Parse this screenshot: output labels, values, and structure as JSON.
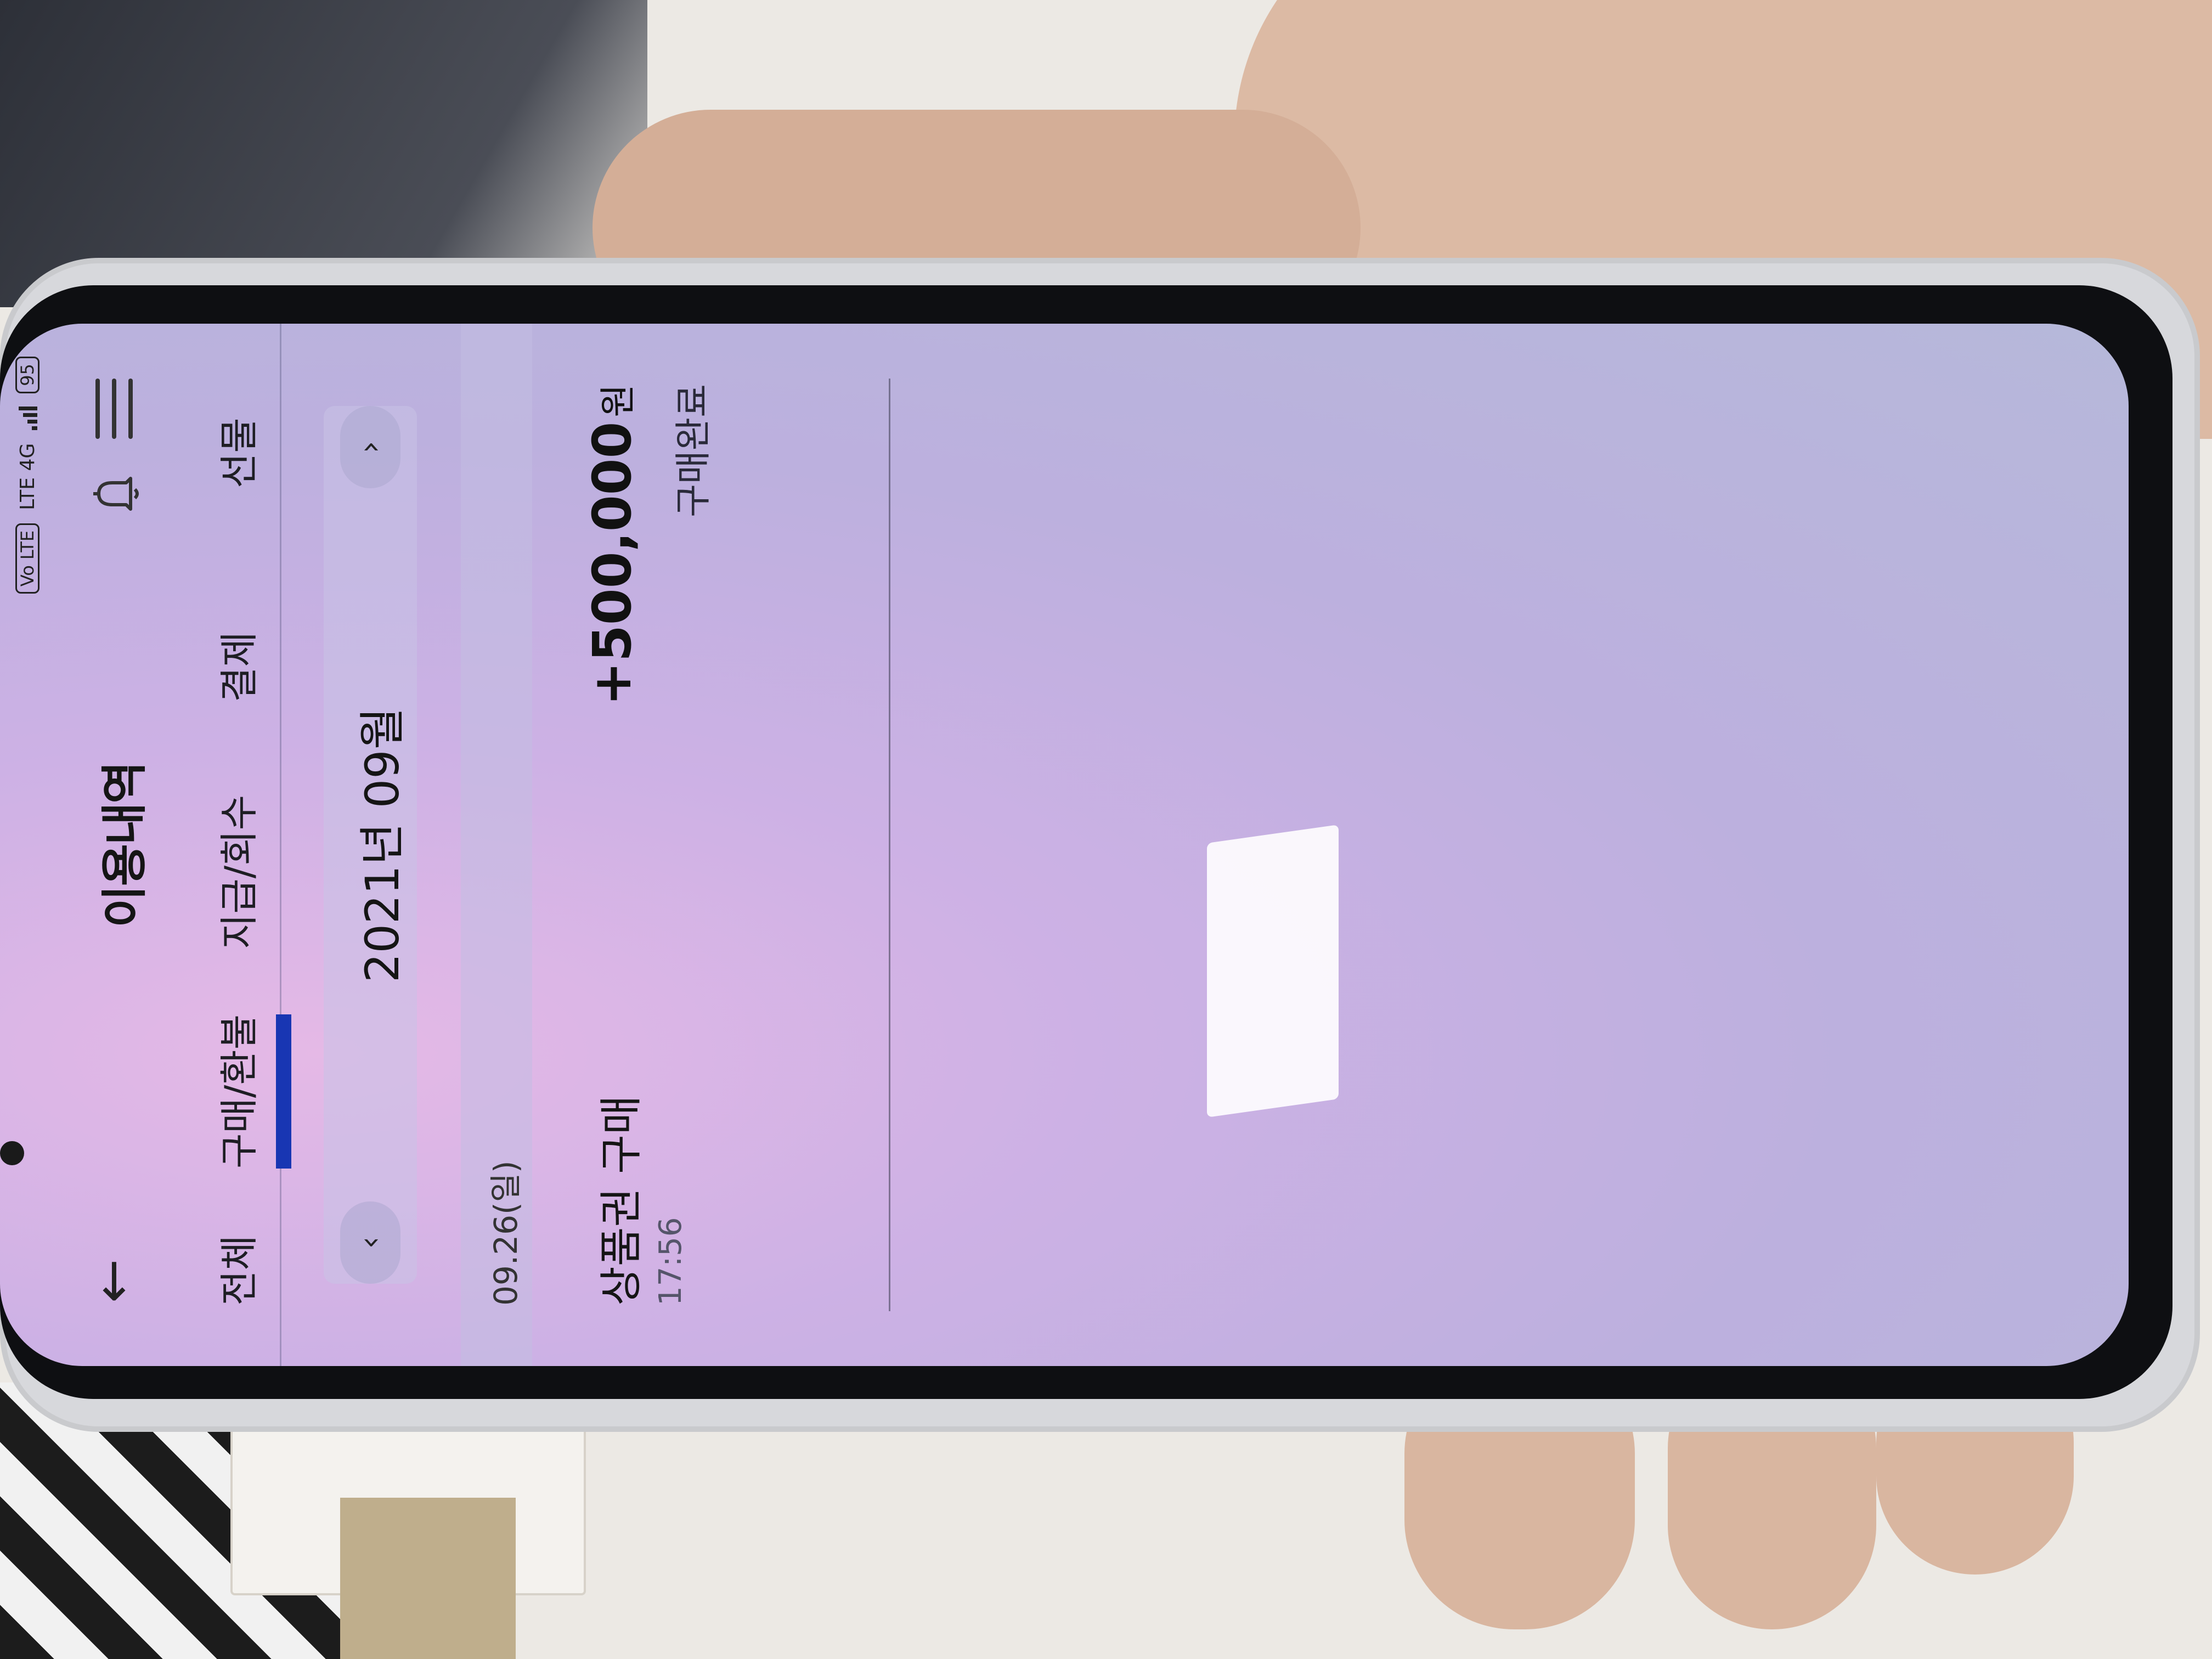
{
  "status_bar": {
    "network_1": "Vo LTE",
    "network_2": "LTE 4G",
    "battery": "95"
  },
  "header": {
    "back_icon": "←",
    "title": "이용내역",
    "bell_icon": "bell-icon",
    "menu_icon": "menu-icon"
  },
  "tabs": [
    {
      "label": "전체",
      "active": false
    },
    {
      "label": "구매/환불",
      "active": true
    },
    {
      "label": "지급/회수",
      "active": false
    },
    {
      "label": "결제",
      "active": false
    },
    {
      "label": "선물",
      "active": false
    }
  ],
  "month_nav": {
    "prev_icon": "‹",
    "label": "2021년 09월",
    "next_icon": "›"
  },
  "date_header": "09.26(일)",
  "transaction": {
    "title": "상품권 구매",
    "time": "17:56",
    "amount": "+500,000",
    "currency": "원",
    "status": "구매완료"
  },
  "colors": {
    "accent": "#1836b3",
    "screen_bg": "#c4b4e2"
  }
}
